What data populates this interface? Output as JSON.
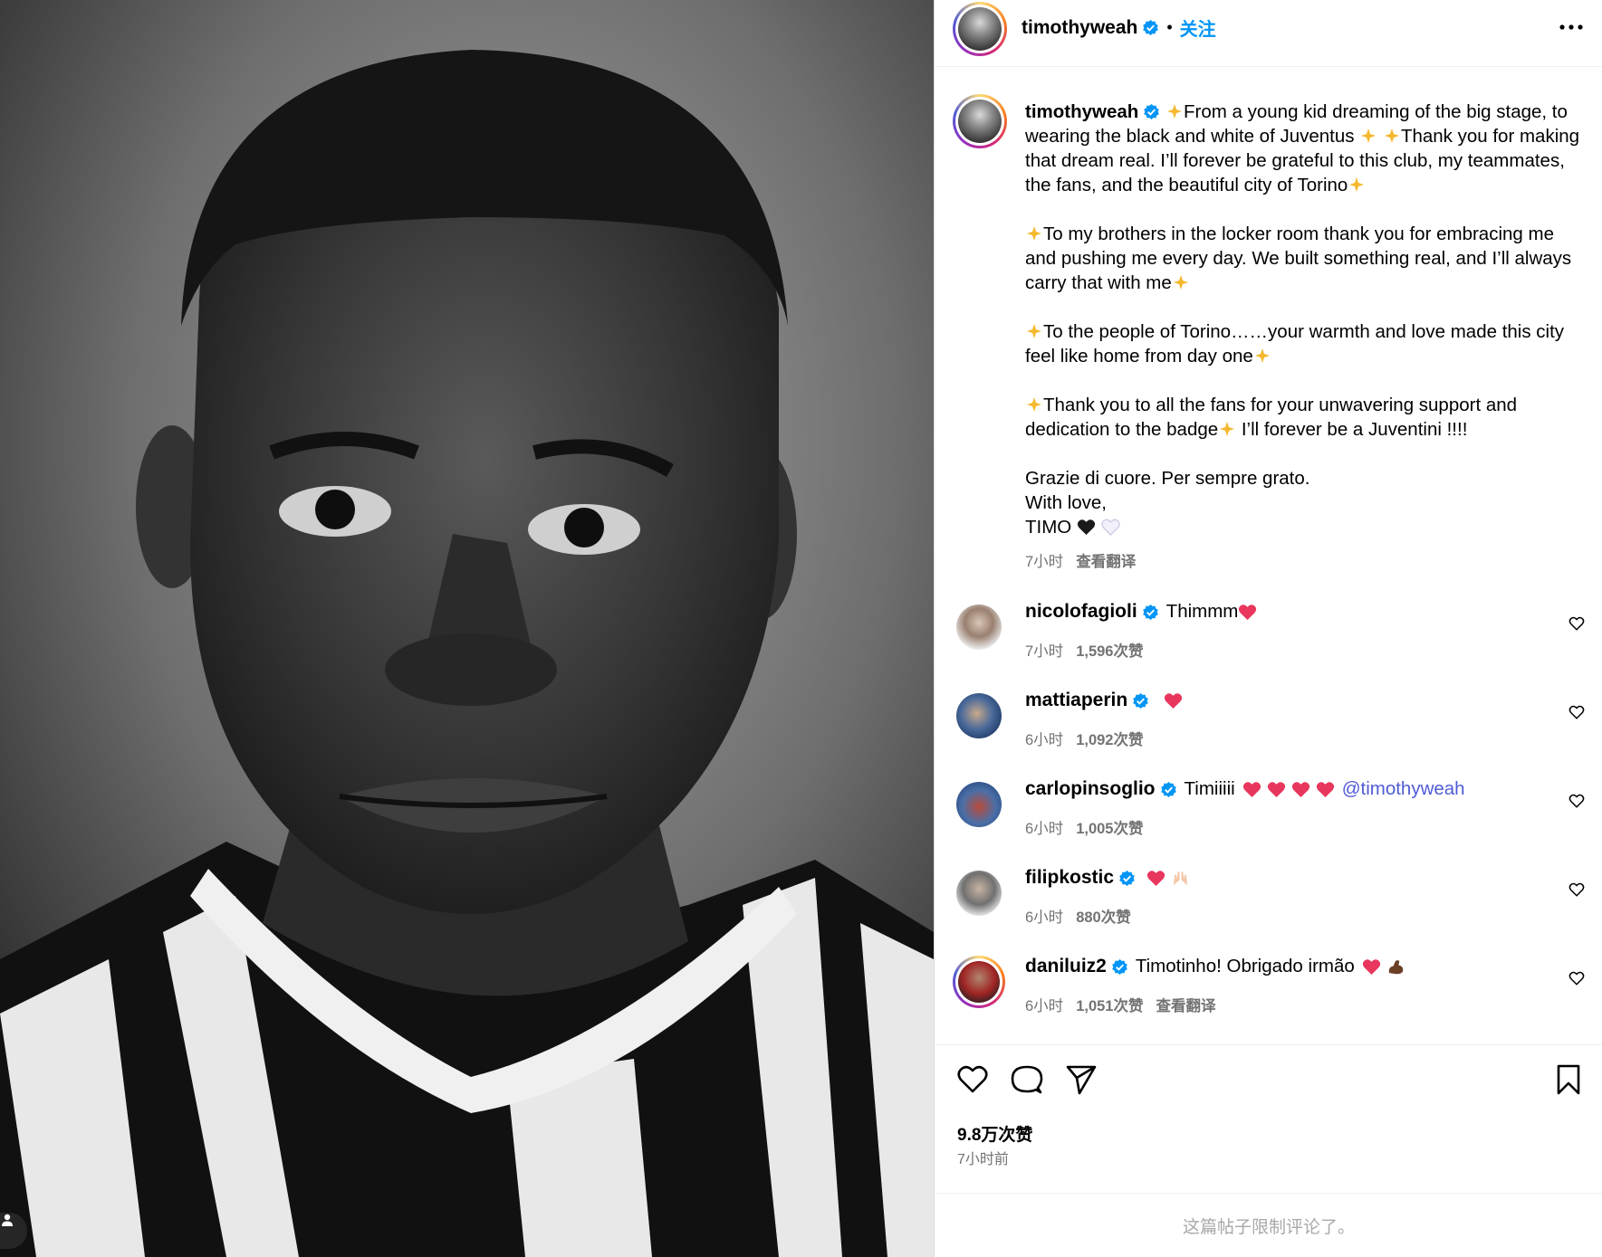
{
  "header": {
    "username": "timothyweah",
    "separator": "•",
    "follow_label": "关注"
  },
  "caption": {
    "username": "timothyweah",
    "paragraphs": [
      [
        "From a young kid dreaming of the big stage, to wearing the black and white of Juventus",
        "Thank you for making that dream real. I’ll forever be grateful to this club, my teammates, the fans, and the beautiful city of Torino"
      ],
      [
        "To my brothers in the locker room thank you for embracing me and pushing me every day. We built something real, and I’ll always carry that with me"
      ],
      [
        "To the people of Torino……your warmth and love made this city feel like home from day one"
      ],
      [
        "Thank you to all the fans for your unwavering support and dedication to the badge",
        "I’ll forever be a Juventini !!!!"
      ]
    ],
    "closing": [
      "Grazie di cuore. Per sempre grato.",
      "With love,",
      "TIMO"
    ],
    "time": "7小时",
    "translate": "查看翻译"
  },
  "comments": [
    {
      "username": "nicolofagioli",
      "text": "Thimmm",
      "time": "7小时",
      "likes": "1,596次赞"
    },
    {
      "username": "mattiaperin",
      "text": "",
      "time": "6小时",
      "likes": "1,092次赞"
    },
    {
      "username": "carlopinsoglio",
      "text": "Timiiiii",
      "mention": "@timothyweah",
      "time": "6小时",
      "likes": "1,005次赞"
    },
    {
      "username": "filipkostic",
      "text": "",
      "time": "6小时",
      "likes": "880次赞"
    },
    {
      "username": "daniluiz2",
      "text": "Timotinho! Obrigado irmão",
      "time": "6小时",
      "likes": "1,051次赞",
      "translate": "查看翻译"
    }
  ],
  "footer": {
    "likes_count": "9.8万次赞",
    "post_time": "7小时前",
    "comments_restricted": "这篇帖子限制评论了。"
  },
  "colors": {
    "link_blue": "#0095f6",
    "mention": "#4f5bd5",
    "verified": "#0095f6",
    "heart_emoji": "#e8365d",
    "meta_grey": "#737373"
  },
  "icons": {
    "verified": "verified-badge-icon",
    "more": "more-horizontal-icon",
    "like": "heart-outline-icon",
    "comment": "comment-bubble-icon",
    "share": "paper-plane-icon",
    "save": "bookmark-icon",
    "user_tags": "person-icon"
  }
}
